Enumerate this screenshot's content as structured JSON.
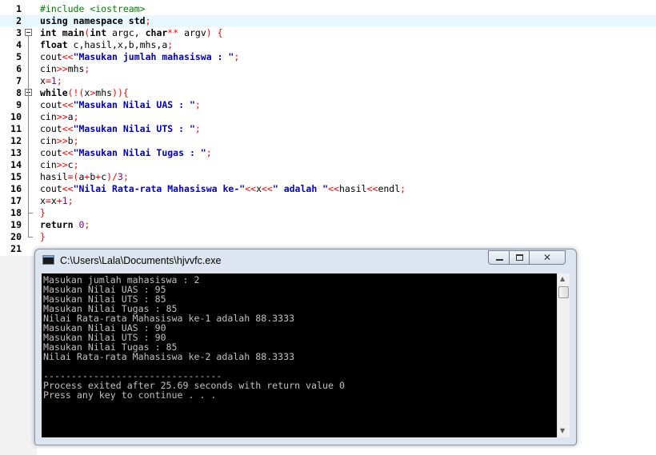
{
  "editor": {
    "lines": [
      {
        "n": "1",
        "tokens": [
          {
            "t": "#include <iostream>",
            "c": "pp"
          }
        ]
      },
      {
        "n": "2",
        "tokens": [
          {
            "t": "using namespace std",
            "c": "kw"
          },
          {
            "t": ";",
            "c": "op"
          }
        ]
      },
      {
        "n": "3",
        "tokens": [
          {
            "t": "int ",
            "c": "kw"
          },
          {
            "t": "main",
            "c": "kw"
          },
          {
            "t": "(",
            "c": "op"
          },
          {
            "t": "int ",
            "c": "kw"
          },
          {
            "t": "argc, ",
            "c": ""
          },
          {
            "t": "char",
            "c": "kw"
          },
          {
            "t": "**",
            "c": "op"
          },
          {
            "t": " argv",
            "c": ""
          },
          {
            "t": ") {",
            "c": "op"
          }
        ]
      },
      {
        "n": "4",
        "tokens": [
          {
            "t": "float ",
            "c": "kw"
          },
          {
            "t": "c,hasil,x,b,mhs,a",
            "c": ""
          },
          {
            "t": ";",
            "c": "op"
          }
        ]
      },
      {
        "n": "5",
        "tokens": [
          {
            "t": "cout",
            "c": ""
          },
          {
            "t": "<<",
            "c": "op"
          },
          {
            "t": "\"Masukan jumlah mahasiswa : \"",
            "c": "str"
          },
          {
            "t": ";",
            "c": "op"
          }
        ]
      },
      {
        "n": "6",
        "tokens": [
          {
            "t": "cin",
            "c": ""
          },
          {
            "t": ">>",
            "c": "op"
          },
          {
            "t": "mhs",
            "c": ""
          },
          {
            "t": ";",
            "c": "op"
          }
        ]
      },
      {
        "n": "7",
        "tokens": [
          {
            "t": "x",
            "c": ""
          },
          {
            "t": "=",
            "c": "op"
          },
          {
            "t": "1",
            "c": "num"
          },
          {
            "t": ";",
            "c": "op"
          }
        ]
      },
      {
        "n": "8",
        "tokens": [
          {
            "t": "while",
            "c": "kw"
          },
          {
            "t": "(!(",
            "c": "op"
          },
          {
            "t": "x",
            "c": ""
          },
          {
            "t": ">",
            "c": "op"
          },
          {
            "t": "mhs",
            "c": ""
          },
          {
            "t": ")){",
            "c": "op"
          }
        ]
      },
      {
        "n": "9",
        "tokens": [
          {
            "t": "cout",
            "c": ""
          },
          {
            "t": "<<",
            "c": "op"
          },
          {
            "t": "\"Masukan Nilai UAS : \"",
            "c": "str"
          },
          {
            "t": ";",
            "c": "op"
          }
        ]
      },
      {
        "n": "10",
        "tokens": [
          {
            "t": "cin",
            "c": ""
          },
          {
            "t": ">>",
            "c": "op"
          },
          {
            "t": "a",
            "c": ""
          },
          {
            "t": ";",
            "c": "op"
          }
        ]
      },
      {
        "n": "11",
        "tokens": [
          {
            "t": "cout",
            "c": ""
          },
          {
            "t": "<<",
            "c": "op"
          },
          {
            "t": "\"Masukan Nilai UTS : \"",
            "c": "str"
          },
          {
            "t": ";",
            "c": "op"
          }
        ]
      },
      {
        "n": "12",
        "tokens": [
          {
            "t": "cin",
            "c": ""
          },
          {
            "t": ">>",
            "c": "op"
          },
          {
            "t": "b",
            "c": ""
          },
          {
            "t": ";",
            "c": "op"
          }
        ]
      },
      {
        "n": "13",
        "tokens": [
          {
            "t": "cout",
            "c": ""
          },
          {
            "t": "<<",
            "c": "op"
          },
          {
            "t": "\"Masukan Nilai Tugas : \"",
            "c": "str"
          },
          {
            "t": ";",
            "c": "op"
          }
        ]
      },
      {
        "n": "14",
        "tokens": [
          {
            "t": "cin",
            "c": ""
          },
          {
            "t": ">>",
            "c": "op"
          },
          {
            "t": "c",
            "c": ""
          },
          {
            "t": ";",
            "c": "op"
          }
        ]
      },
      {
        "n": "15",
        "tokens": [
          {
            "t": "hasil",
            "c": ""
          },
          {
            "t": "=(",
            "c": "op"
          },
          {
            "t": "a",
            "c": ""
          },
          {
            "t": "+",
            "c": "op"
          },
          {
            "t": "b",
            "c": ""
          },
          {
            "t": "+",
            "c": "op"
          },
          {
            "t": "c",
            "c": ""
          },
          {
            "t": ")/",
            "c": "op"
          },
          {
            "t": "3",
            "c": "num"
          },
          {
            "t": ";",
            "c": "op"
          }
        ]
      },
      {
        "n": "16",
        "tokens": [
          {
            "t": "cout",
            "c": ""
          },
          {
            "t": "<<",
            "c": "op"
          },
          {
            "t": "\"Nilai Rata-rata Mahasiswa ke-\"",
            "c": "str"
          },
          {
            "t": "<<",
            "c": "op"
          },
          {
            "t": "x",
            "c": ""
          },
          {
            "t": "<<",
            "c": "op"
          },
          {
            "t": "\" adalah \"",
            "c": "str"
          },
          {
            "t": "<<",
            "c": "op"
          },
          {
            "t": "hasil",
            "c": ""
          },
          {
            "t": "<<",
            "c": "op"
          },
          {
            "t": "endl",
            "c": ""
          },
          {
            "t": ";",
            "c": "op"
          }
        ]
      },
      {
        "n": "17",
        "tokens": [
          {
            "t": "x",
            "c": ""
          },
          {
            "t": "=",
            "c": "op"
          },
          {
            "t": "x",
            "c": ""
          },
          {
            "t": "+",
            "c": "op"
          },
          {
            "t": "1",
            "c": "num"
          },
          {
            "t": ";",
            "c": "op"
          }
        ]
      },
      {
        "n": "18",
        "tokens": [
          {
            "t": "}",
            "c": "op"
          }
        ]
      },
      {
        "n": "19",
        "tokens": [
          {
            "t": "return ",
            "c": "kw"
          },
          {
            "t": "0",
            "c": "num"
          },
          {
            "t": ";",
            "c": "op"
          }
        ]
      },
      {
        "n": "20",
        "tokens": [
          {
            "t": "}",
            "c": "op"
          }
        ]
      },
      {
        "n": "21",
        "tokens": []
      }
    ]
  },
  "console": {
    "title": "C:\\Users\\Lala\\Documents\\hjvvfc.exe",
    "lines": [
      "Masukan jumlah mahasiswa : 2",
      "Masukan Nilai UAS : 95",
      "Masukan Nilai UTS : 85",
      "Masukan Nilai Tugas : 85",
      "Nilai Rata-rata Mahasiswa ke-1 adalah 88.3333",
      "Masukan Nilai UAS : 90",
      "Masukan Nilai UTS : 90",
      "Masukan Nilai Tugas : 85",
      "Nilai Rata-rata Mahasiswa ke-2 adalah 88.3333",
      "",
      "--------------------------------",
      "Process exited after 25.69 seconds with return value 0",
      "Press any key to continue . . ."
    ]
  },
  "colors": {
    "keyword": "#000000",
    "preprocessor": "#008000",
    "string": "#0000c0",
    "number": "#800080",
    "operator": "#ff0000",
    "current_line_highlight": "#e8f8ff",
    "console_background": "#000000",
    "console_text": "#c0c0c0"
  },
  "icons": {
    "console_icon": "console-window-icon",
    "minimize": "minimize-icon",
    "maximize": "maximize-icon",
    "close": "close-icon",
    "scroll_up": "scroll-up-arrow-icon",
    "scroll_down": "scroll-down-arrow-icon",
    "fold": "fold-collapse-icon"
  }
}
